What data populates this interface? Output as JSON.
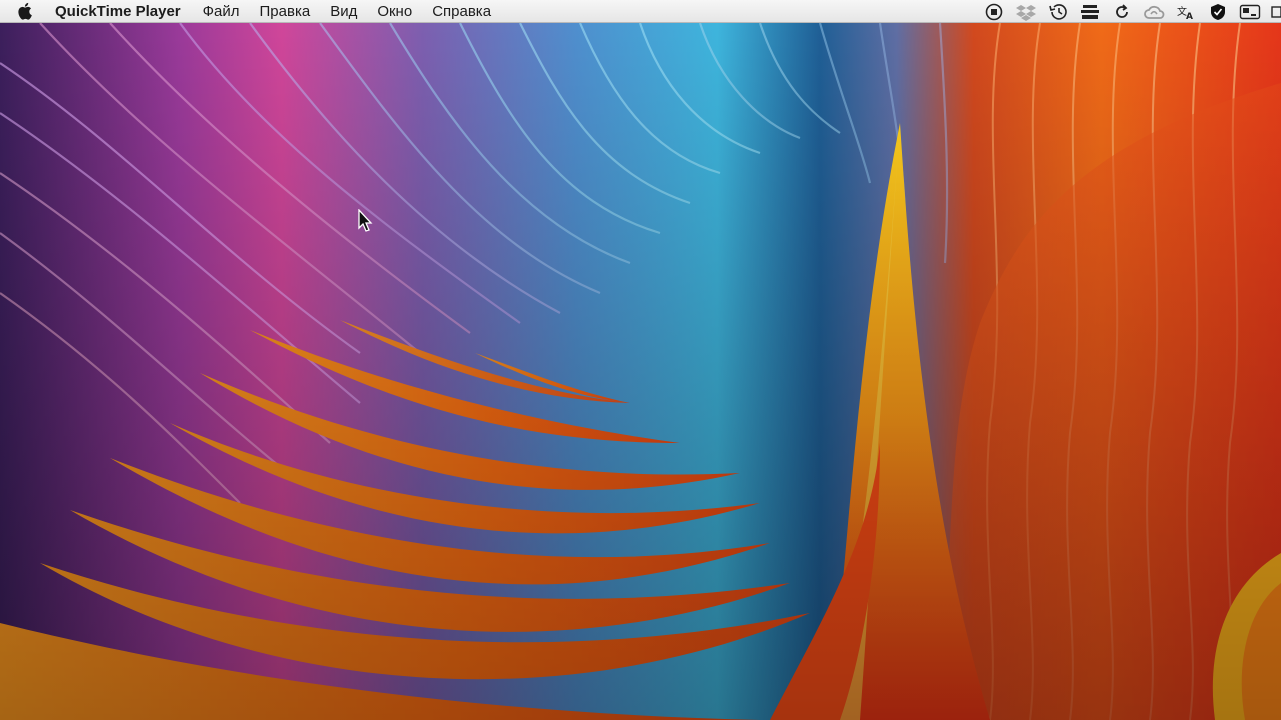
{
  "menubar": {
    "app_name": "QuickTime Player",
    "items": [
      {
        "label": "Файл"
      },
      {
        "label": "Правка"
      },
      {
        "label": "Вид"
      },
      {
        "label": "Окно"
      },
      {
        "label": "Справка"
      }
    ],
    "status_icons": [
      "record-stop-icon",
      "dropbox-icon",
      "time-machine-icon",
      "stack-icon",
      "sync-icon",
      "creative-cloud-icon",
      "translate-icon",
      "vpn-shield-icon",
      "keyboard-layout-icon",
      "battery-icon"
    ]
  },
  "desktop": {
    "wallpaper": "macOS Sierra abstract wave wallpaper",
    "colors": {
      "purple": "#6b2f8f",
      "magenta": "#c7358f",
      "blue": "#2e6fae",
      "cyan": "#4fc3e0",
      "orange": "#ff7a1a",
      "red": "#e8321c",
      "yellow": "#ffc21a"
    }
  }
}
